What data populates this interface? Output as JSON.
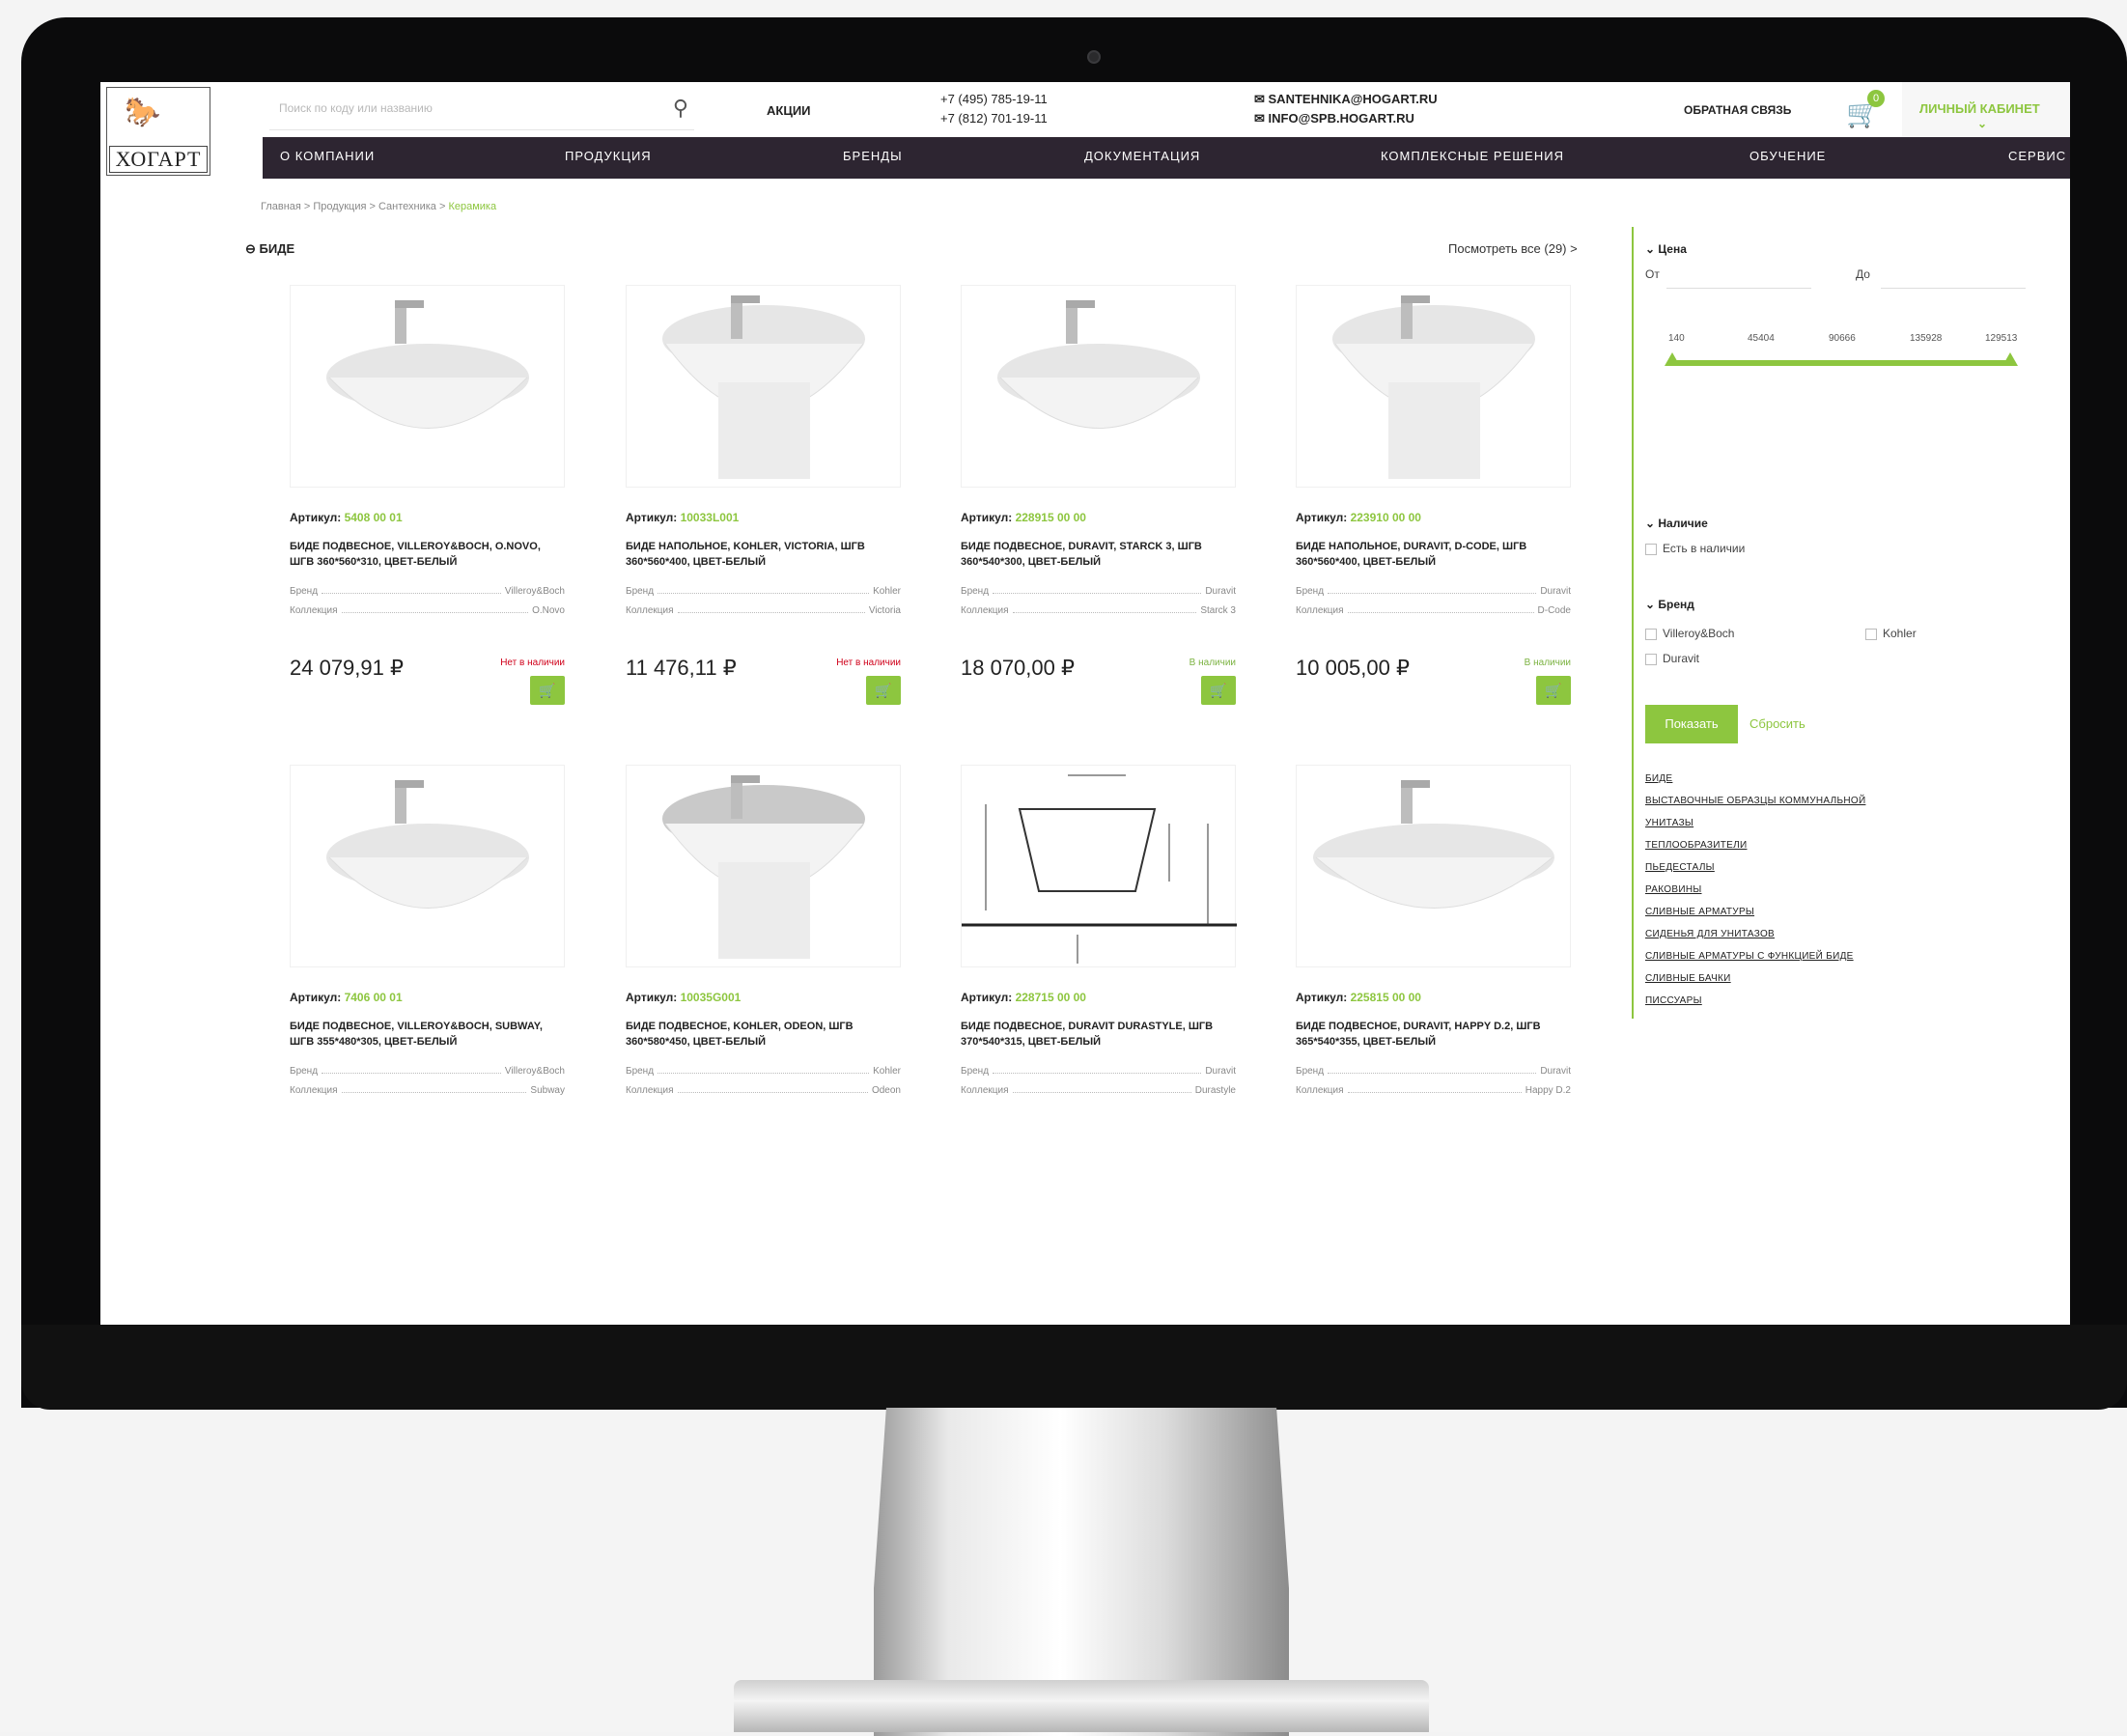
{
  "header": {
    "logo_text": "ХОГАРТ",
    "search_placeholder": "Поиск по коду или названию",
    "promo": "АКЦИИ",
    "phones": [
      "+7 (495) 785-19-11",
      "+7 (812) 701-19-11"
    ],
    "emails": [
      "SANTEHNIKA@HOGART.RU",
      "INFO@SPB.HOGART.RU"
    ],
    "feedback": "ОБРАТНАЯ СВЯЗЬ",
    "cart_count": "0",
    "cabinet": "ЛИЧНЫЙ КАБИНЕТ"
  },
  "nav": [
    "О КОМПАНИИ",
    "ПРОДУКЦИЯ",
    "БРЕНДЫ",
    "ДОКУМЕНТАЦИЯ",
    "КОМПЛЕКСНЫЕ РЕШЕНИЯ",
    "ОБУЧЕНИЕ",
    "СЕРВИС"
  ],
  "breadcrumb": {
    "path": "Главная > Продукция > Сантехника > ",
    "current": "Керамика"
  },
  "section": {
    "title": "⊖ БИДЕ",
    "view_all": "Посмотреть все (29) >"
  },
  "products": [
    {
      "art_label": "Артикул:",
      "art": "5408 00 01",
      "name": "БИДЕ ПОДВЕСНОЕ, VILLEROY&BOCH, O.NOVO, ШГВ 360*560*310, ЦВЕТ-БЕЛЫЙ",
      "brand_label": "Бренд",
      "brand": "Villeroy&Boch",
      "coll_label": "Коллекция",
      "coll": "O.Novo",
      "price": "24 079,91 ₽",
      "avail": "Нет в наличии",
      "avail_color": "#d0021b",
      "buy": "🛒"
    },
    {
      "art_label": "Артикул:",
      "art": "10033L001",
      "name": "БИДЕ НАПОЛЬНОЕ, KOHLER, VICTORIA, ШГВ 360*560*400, ЦВЕТ-БЕЛЫЙ",
      "brand_label": "Бренд",
      "brand": "Kohler",
      "coll_label": "Коллекция",
      "coll": "Victoria",
      "price": "11 476,11 ₽",
      "avail": "Нет в наличии",
      "avail_color": "#d0021b",
      "buy": "🛒"
    },
    {
      "art_label": "Артикул:",
      "art": "228915 00 00",
      "name": "БИДЕ ПОДВЕСНОЕ, DURAVIT, STARCK 3, ШГВ 360*540*300, ЦВЕТ-БЕЛЫЙ",
      "brand_label": "Бренд",
      "brand": "Duravit",
      "coll_label": "Коллекция",
      "coll": "Starck 3",
      "price": "18 070,00 ₽",
      "avail": "В наличии",
      "avail_color": "#7cb342",
      "buy": "🛒"
    },
    {
      "art_label": "Артикул:",
      "art": "223910 00 00",
      "name": "БИДЕ НАПОЛЬНОЕ, DURAVIT, D-CODE, ШГВ 360*560*400, ЦВЕТ-БЕЛЫЙ",
      "brand_label": "Бренд",
      "brand": "Duravit",
      "coll_label": "Коллекция",
      "coll": "D-Code",
      "price": "10 005,00 ₽",
      "avail": "В наличии",
      "avail_color": "#7cb342",
      "buy": "🛒"
    },
    {
      "art_label": "Артикул:",
      "art": "7406 00 01",
      "name": "БИДЕ ПОДВЕСНОЕ, VILLEROY&BOCH, SUBWAY, ШГВ 355*480*305, ЦВЕТ-БЕЛЫЙ",
      "brand_label": "Бренд",
      "brand": "Villeroy&Boch",
      "coll_label": "Коллекция",
      "coll": "Subway",
      "price": "",
      "avail": "",
      "avail_color": "#7cb342",
      "buy": ""
    },
    {
      "art_label": "Артикул:",
      "art": "10035G001",
      "name": "БИДЕ ПОДВЕСНОЕ, KOHLER, ODEON, ШГВ 360*580*450, ЦВЕТ-БЕЛЫЙ",
      "brand_label": "Бренд",
      "brand": "Kohler",
      "coll_label": "Коллекция",
      "coll": "Odeon",
      "price": "",
      "avail": "",
      "avail_color": "#7cb342",
      "buy": ""
    },
    {
      "art_label": "Артикул:",
      "art": "228715 00 00",
      "name": "БИДЕ ПОДВЕСНОЕ, DURAVIT DURASTYLE, ШГВ 370*540*315, ЦВЕТ-БЕЛЫЙ",
      "brand_label": "Бренд",
      "brand": "Duravit",
      "coll_label": "Коллекция",
      "coll": "Durastyle",
      "price": "",
      "avail": "",
      "avail_color": "#7cb342",
      "buy": ""
    },
    {
      "art_label": "Артикул:",
      "art": "225815 00 00",
      "name": "БИДЕ ПОДВЕСНОЕ, DURAVIT, HAPPY D.2, ШГВ 365*540*355, ЦВЕТ-БЕЛЫЙ",
      "brand_label": "Бренд",
      "brand": "Duravit",
      "coll_label": "Коллекция",
      "coll": "Happy D.2",
      "price": "",
      "avail": "",
      "avail_color": "#7cb342",
      "buy": ""
    }
  ],
  "filters": {
    "price_label": "Цена",
    "from_label": "От",
    "to_label": "До",
    "ticks": [
      "140",
      "45404",
      "90666",
      "135928",
      "129513"
    ],
    "availability_label": "Наличие",
    "in_stock": "Есть в наличии",
    "brand_label": "Бренд",
    "brands": [
      "Villeroy&Boch",
      "Kohler",
      "Duravit"
    ],
    "show": "Показать",
    "reset": "Сбросить",
    "categories": [
      "БИДЕ",
      "ВЫСТАВОЧНЫЕ ОБРАЗЦЫ КОММУНАЛЬНОЙ",
      "УНИТАЗЫ",
      "ТЕПЛООБРАЗИТЕЛИ",
      "ПЬЕДЕСТАЛЫ",
      "РАКОВИНЫ",
      "СЛИВНЫЕ АРМАТУРЫ",
      "СИДЕНЬЯ ДЛЯ УНИТАЗОВ",
      "СЛИВНЫЕ АРМАТУРЫ С ФУНКЦИЕЙ БИДЕ",
      "СЛИВНЫЕ БАЧКИ",
      "ПИССУАРЫ"
    ]
  }
}
